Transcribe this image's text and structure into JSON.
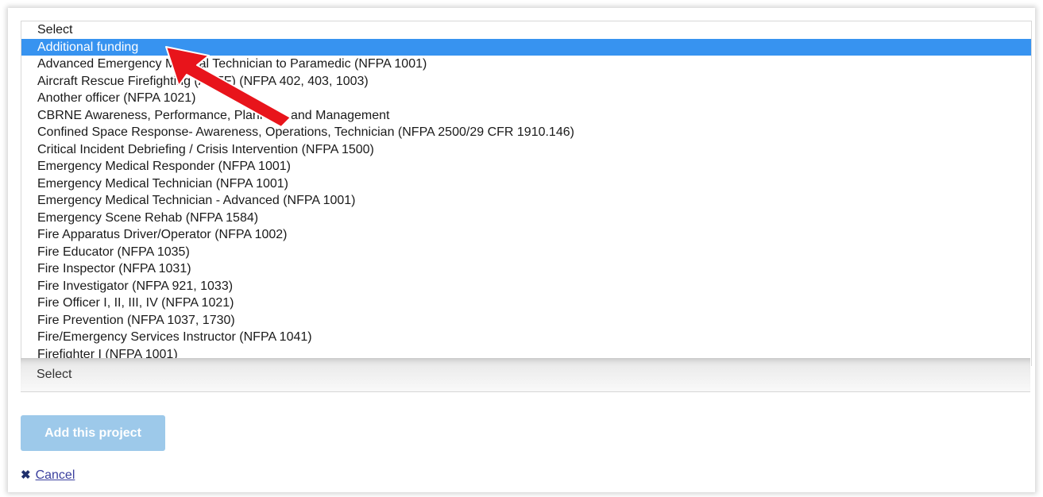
{
  "listbox": {
    "options": [
      "Select",
      "Additional funding",
      "Advanced Emergency Medical Technician to Paramedic (NFPA 1001)",
      "Aircraft Rescue Firefighting (ARFF) (NFPA 402, 403, 1003)",
      "Another officer (NFPA 1021)",
      "CBRNE Awareness, Performance, Planning, and Management",
      "Confined Space Response- Awareness, Operations, Technician (NFPA 2500/29 CFR 1910.146)",
      "Critical Incident Debriefing / Crisis Intervention (NFPA 1500)",
      "Emergency Medical Responder (NFPA 1001)",
      "Emergency Medical Technician (NFPA 1001)",
      "Emergency Medical Technician - Advanced (NFPA 1001)",
      "Emergency Scene Rehab (NFPA 1584)",
      "Fire Apparatus Driver/Operator (NFPA 1002)",
      "Fire Educator (NFPA 1035)",
      "Fire Inspector (NFPA 1031)",
      "Fire Investigator (NFPA 921, 1033)",
      "Fire Officer I, II, III, IV (NFPA 1021)",
      "Fire Prevention (NFPA 1037, 1730)",
      "Fire/Emergency Services Instructor (NFPA 1041)",
      "Firefighter I (NFPA 1001)"
    ],
    "selected_option": "Additional funding"
  },
  "select_field": {
    "value": "Select"
  },
  "add_button": {
    "label": "Add this project"
  },
  "cancel": {
    "icon": "close-icon",
    "label": "Cancel"
  },
  "colors": {
    "selected_highlight": "#3793f0",
    "annotation_arrow": "#e8141b",
    "button_bg": "#9dc9ea",
    "link": "#3a3f9e"
  }
}
